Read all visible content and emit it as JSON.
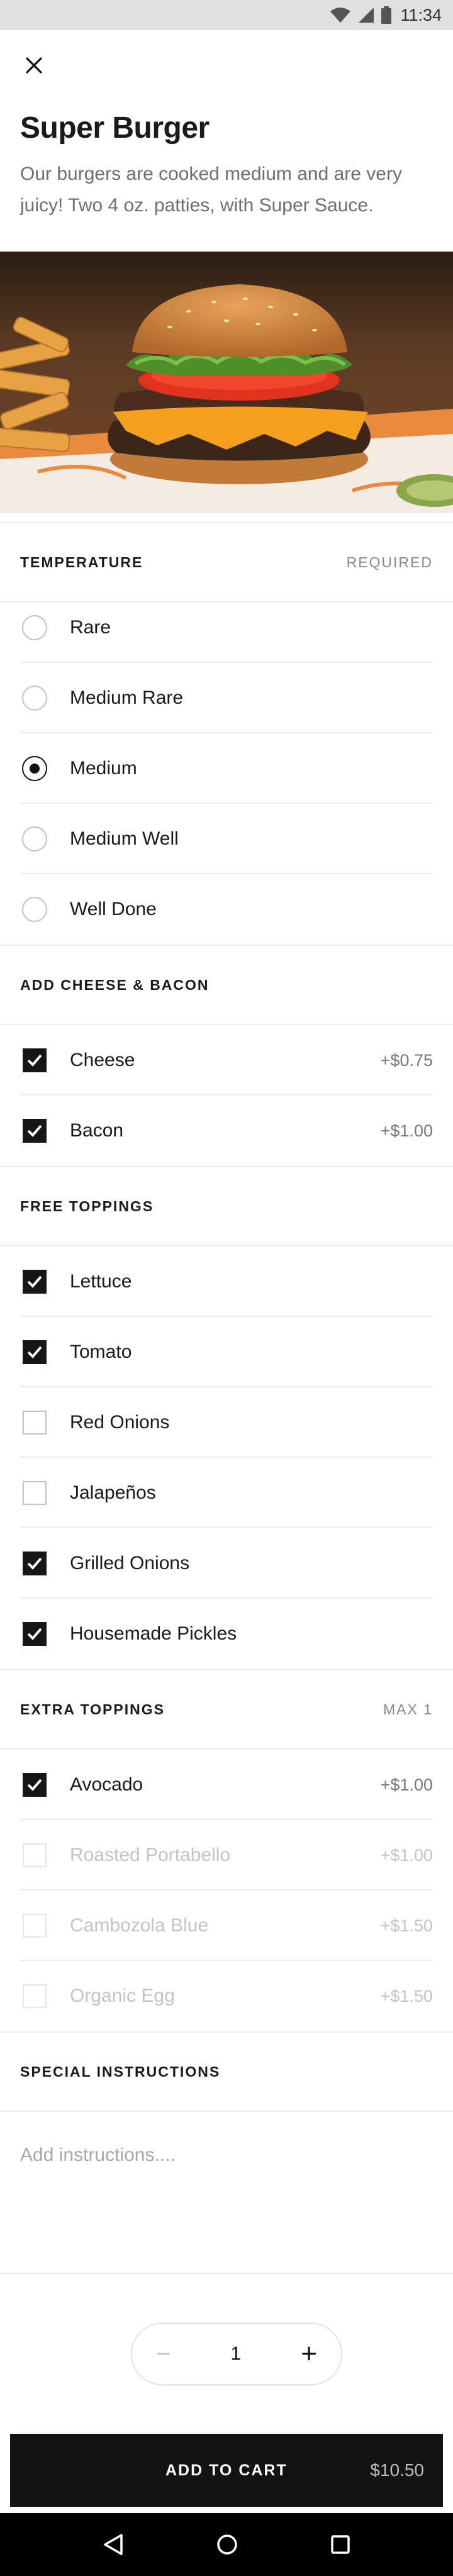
{
  "status_bar": {
    "time": "11:34"
  },
  "item": {
    "title": "Super Burger",
    "description": "Our burgers are cooked medium and are very juicy! Two 4 oz. patties, with Super Sauce."
  },
  "temperature": {
    "title": "TEMPERATURE",
    "note": "REQUIRED",
    "options": [
      {
        "label": "Rare",
        "selected": false
      },
      {
        "label": "Medium Rare",
        "selected": false
      },
      {
        "label": "Medium",
        "selected": true
      },
      {
        "label": "Medium Well",
        "selected": false
      },
      {
        "label": "Well Done",
        "selected": false
      }
    ]
  },
  "cheese_bacon": {
    "title": "ADD CHEESE & BACON",
    "options": [
      {
        "label": "Cheese",
        "price": "+$0.75",
        "checked": true
      },
      {
        "label": "Bacon",
        "price": "+$1.00",
        "checked": true
      }
    ]
  },
  "free_toppings": {
    "title": "FREE TOPPINGS",
    "options": [
      {
        "label": "Lettuce",
        "checked": true
      },
      {
        "label": "Tomato",
        "checked": true
      },
      {
        "label": "Red Onions",
        "checked": false
      },
      {
        "label": "Jalapeños",
        "checked": false
      },
      {
        "label": "Grilled Onions",
        "checked": true
      },
      {
        "label": "Housemade Pickles",
        "checked": true
      }
    ]
  },
  "extra_toppings": {
    "title": "EXTRA TOPPINGS",
    "note": "MAX 1",
    "options": [
      {
        "label": "Avocado",
        "price": "+$1.00",
        "checked": true,
        "disabled": false
      },
      {
        "label": "Roasted Portabello",
        "price": "+$1.00",
        "checked": false,
        "disabled": true
      },
      {
        "label": "Cambozola Blue",
        "price": "+$1.50",
        "checked": false,
        "disabled": true
      },
      {
        "label": "Organic Egg",
        "price": "+$1.50",
        "checked": false,
        "disabled": true
      }
    ]
  },
  "special_instructions": {
    "title": "SPECIAL INSTRUCTIONS",
    "placeholder": "Add instructions...."
  },
  "quantity": {
    "value": "1",
    "minus": "−",
    "plus": "+"
  },
  "cart": {
    "label": "ADD TO CART",
    "price": "$10.50"
  },
  "colors": {
    "accent": "#131313",
    "muted": "#8a8a8a",
    "divider": "#ececec"
  },
  "icons": [
    "wifi-icon",
    "signal-icon",
    "battery-icon",
    "close-icon",
    "checkmark-icon",
    "back-icon",
    "home-icon",
    "recents-icon"
  ]
}
